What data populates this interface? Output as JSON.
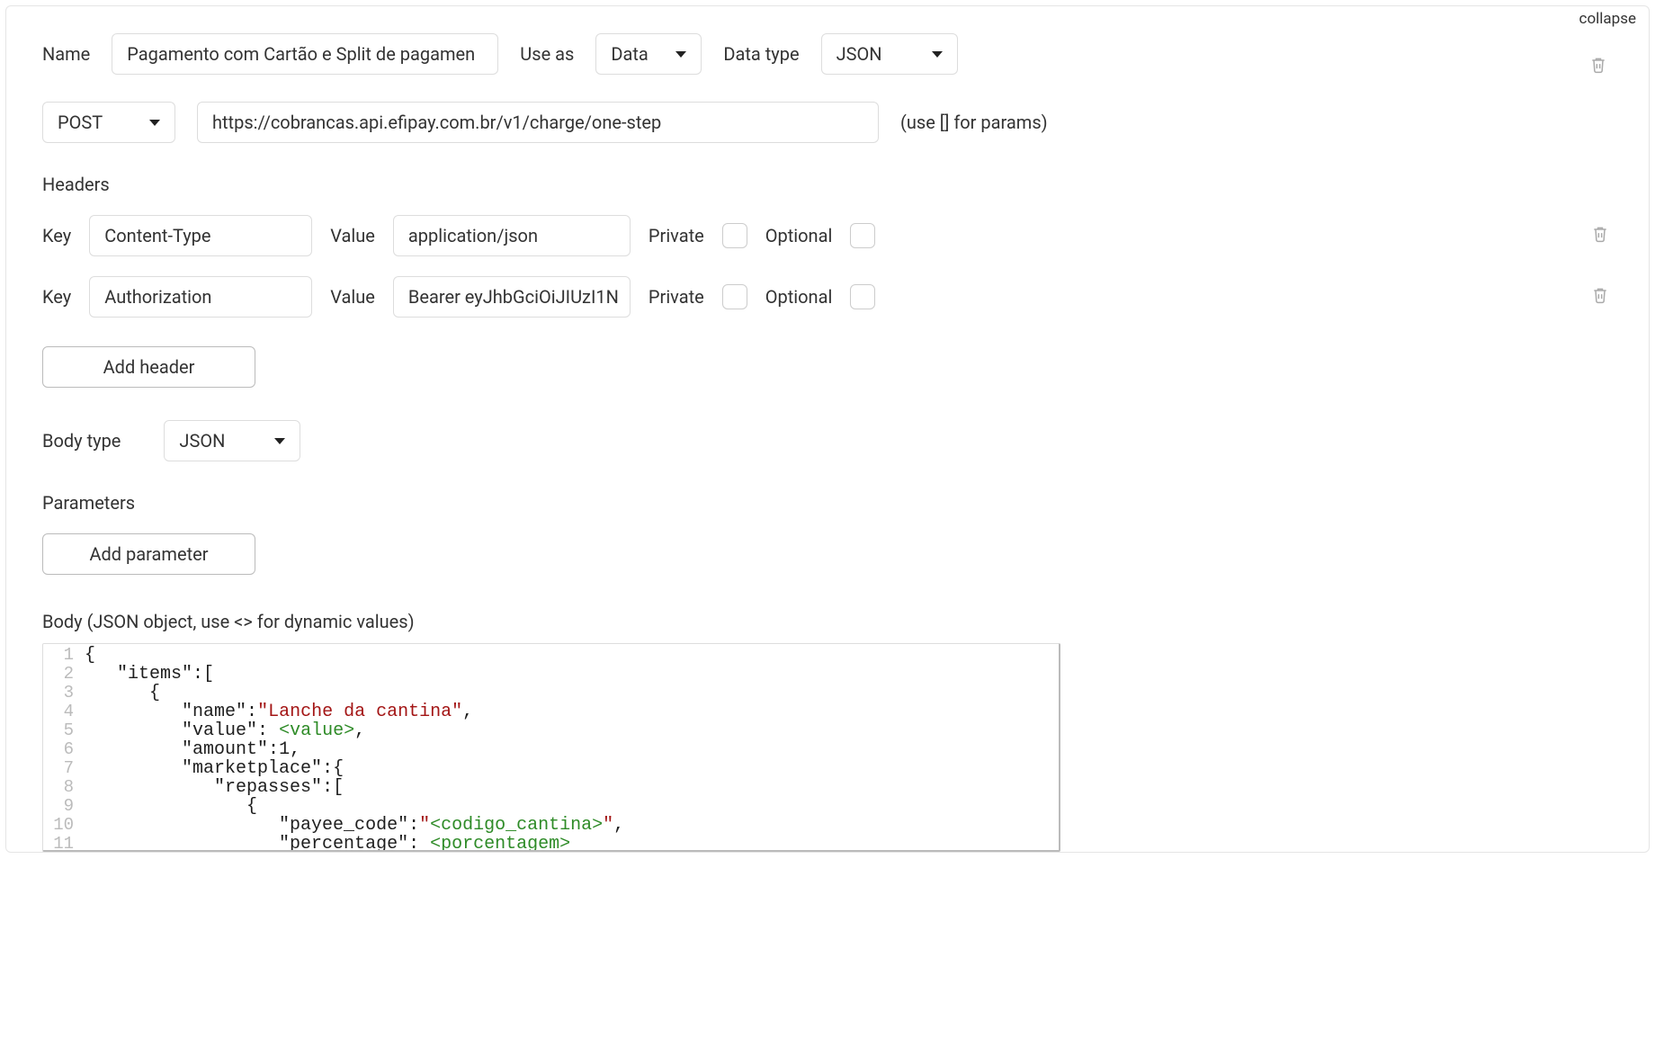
{
  "collapse_label": "collapse",
  "top": {
    "name_label": "Name",
    "name_value": "Pagamento com Cartão e Split de pagamen",
    "useas_label": "Use as",
    "useas_value": "Data",
    "datatype_label": "Data type",
    "datatype_value": "JSON"
  },
  "request": {
    "method": "POST",
    "url": "https://cobrancas.api.efipay.com.br/v1/charge/one-step",
    "url_hint": "(use [] for params)"
  },
  "headers": {
    "title": "Headers",
    "key_label": "Key",
    "value_label": "Value",
    "private_label": "Private",
    "optional_label": "Optional",
    "rows": [
      {
        "key": "Content-Type",
        "value": "application/json"
      },
      {
        "key": "Authorization",
        "value": "Bearer eyJhbGciOiJIUzI1N"
      }
    ],
    "add_label": "Add header"
  },
  "bodytype": {
    "label": "Body type",
    "value": "JSON"
  },
  "parameters": {
    "title": "Parameters",
    "add_label": "Add parameter"
  },
  "body": {
    "label": "Body (JSON object, use <> for dynamic values)",
    "lines": [
      {
        "n": "1",
        "segs": [
          {
            "t": "{",
            "c": ""
          }
        ]
      },
      {
        "n": "2",
        "segs": [
          {
            "t": "   ",
            "c": ""
          },
          {
            "t": "\"items\"",
            "c": "tok-key"
          },
          {
            "t": ":[",
            "c": ""
          }
        ]
      },
      {
        "n": "3",
        "segs": [
          {
            "t": "      {",
            "c": ""
          }
        ]
      },
      {
        "n": "4",
        "segs": [
          {
            "t": "         ",
            "c": ""
          },
          {
            "t": "\"name\"",
            "c": "tok-key"
          },
          {
            "t": ":",
            "c": ""
          },
          {
            "t": "\"Lanche da cantina\"",
            "c": "tok-str"
          },
          {
            "t": ",",
            "c": ""
          }
        ]
      },
      {
        "n": "5",
        "segs": [
          {
            "t": "         ",
            "c": ""
          },
          {
            "t": "\"value\"",
            "c": "tok-key"
          },
          {
            "t": ": ",
            "c": ""
          },
          {
            "t": "<value>",
            "c": "tok-dyn"
          },
          {
            "t": ",",
            "c": ""
          }
        ]
      },
      {
        "n": "6",
        "segs": [
          {
            "t": "         ",
            "c": ""
          },
          {
            "t": "\"amount\"",
            "c": "tok-key"
          },
          {
            "t": ":",
            "c": ""
          },
          {
            "t": "1",
            "c": "tok-num"
          },
          {
            "t": ",",
            "c": ""
          }
        ]
      },
      {
        "n": "7",
        "segs": [
          {
            "t": "         ",
            "c": ""
          },
          {
            "t": "\"marketplace\"",
            "c": "tok-key"
          },
          {
            "t": ":{",
            "c": ""
          }
        ]
      },
      {
        "n": "8",
        "segs": [
          {
            "t": "            ",
            "c": ""
          },
          {
            "t": "\"repasses\"",
            "c": "tok-key"
          },
          {
            "t": ":[",
            "c": ""
          }
        ]
      },
      {
        "n": "9",
        "segs": [
          {
            "t": "               {",
            "c": ""
          }
        ]
      },
      {
        "n": "10",
        "segs": [
          {
            "t": "                  ",
            "c": ""
          },
          {
            "t": "\"payee_code\"",
            "c": "tok-key"
          },
          {
            "t": ":",
            "c": ""
          },
          {
            "t": "\"",
            "c": "tok-str"
          },
          {
            "t": "<codigo_cantina>",
            "c": "tok-dyn"
          },
          {
            "t": "\"",
            "c": "tok-str"
          },
          {
            "t": ",",
            "c": ""
          }
        ]
      },
      {
        "n": "11",
        "segs": [
          {
            "t": "                  ",
            "c": ""
          },
          {
            "t": "\"percentage\"",
            "c": "tok-key"
          },
          {
            "t": ": ",
            "c": ""
          },
          {
            "t": "<porcentagem>",
            "c": "tok-dyn"
          }
        ]
      }
    ]
  }
}
